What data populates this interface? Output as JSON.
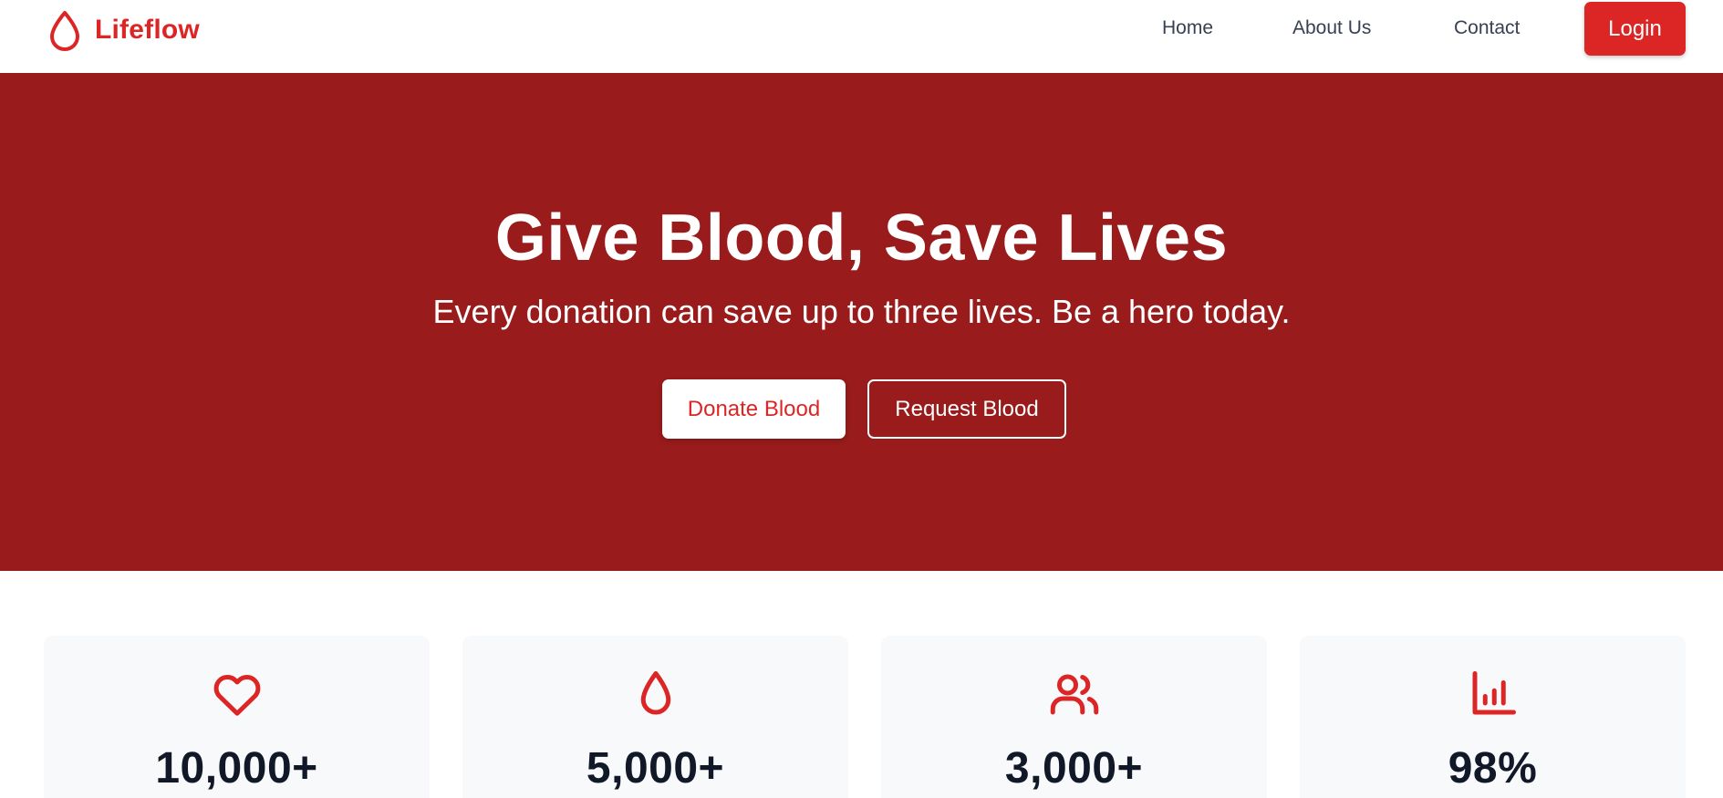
{
  "brand": {
    "name": "Lifeflow",
    "icon": "blood-drop-icon",
    "color": "#dc2626"
  },
  "nav": {
    "links": [
      "Home",
      "About Us",
      "Contact"
    ],
    "login_label": "Login"
  },
  "hero": {
    "title": "Give Blood, Save Lives",
    "subtitle": "Every donation can save up to three lives. Be a hero today.",
    "donate_label": "Donate Blood",
    "request_label": "Request Blood",
    "background": "#991b1b"
  },
  "stats": [
    {
      "icon": "heart-icon",
      "value": "10,000+"
    },
    {
      "icon": "blood-drop-icon",
      "value": "5,000+"
    },
    {
      "icon": "users-icon",
      "value": "3,000+"
    },
    {
      "icon": "bar-chart-icon",
      "value": "98%"
    }
  ]
}
